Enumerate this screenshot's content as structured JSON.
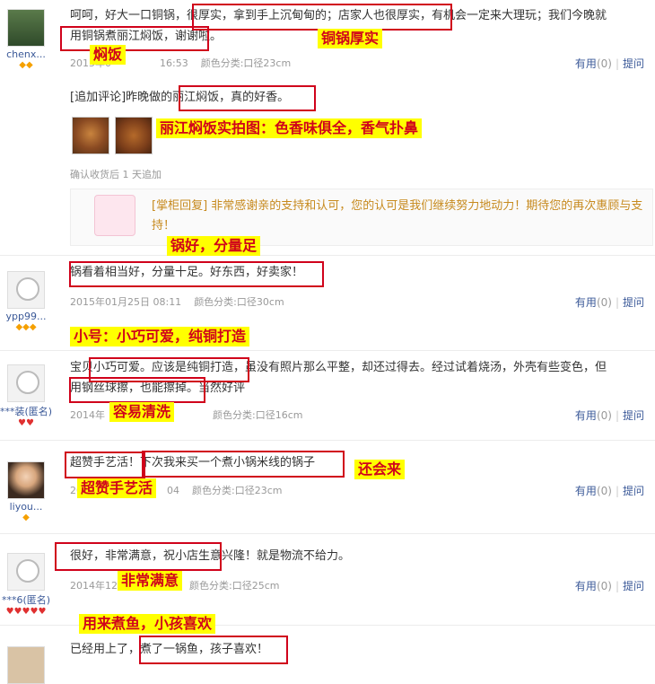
{
  "labels": {
    "useful": "有用",
    "useful_count": "(0)",
    "ask": "提问"
  },
  "reviews": [
    {
      "user": "chenx...",
      "badge": "◆◆",
      "text_lines": [
        "呵呵，好大一口铜锅，很厚实，拿到手上沉甸甸的；店家人也很厚实，有机会一定来大理玩；我们今晚就",
        "用铜锅煮丽江焖饭，谢谢啦。"
      ],
      "date": "2015年0",
      "time": "16:53",
      "spec": "颜色分类:口径23cm",
      "followup_label": "[追加评论]",
      "followup_text": "昨晚做的丽江焖饭，真的好香。",
      "followup_note": "确认收货后 1 天追加",
      "reply": "[掌柜回复] 非常感谢亲的支持和认可，您的认可是我们继续努力地动力！期待您的再次惠顾与支持！"
    },
    {
      "user": "ypp99...",
      "badge": "◆◆◆",
      "text": "锅看着相当好，分量十足。好东西，好卖家！",
      "date": "2015年01月25日 08:11",
      "spec": "颜色分类:口径30cm"
    },
    {
      "user": "***装(匿名)",
      "badge": "♥♥",
      "text_lines": [
        "宝贝小巧可爱。应该是纯铜打造，虽没有照片那么平整，却还过得去。经过试着烧汤，外壳有些变色，但",
        "用钢丝球擦，也能擦掉。当然好评"
      ],
      "date": "2014年",
      "spec": "颜色分类:口径16cm"
    },
    {
      "user": "liyou...",
      "badge": "◆",
      "text_a": "超赞手艺活！",
      "text_b": "下次我来买一个煮小锅米线的锅子",
      "date": "20",
      "time": "04",
      "spec": "颜色分类:口径23cm"
    },
    {
      "user": "***6(匿名)",
      "badge": "♥♥♥♥♥",
      "text": "很好，非常满意，祝小店生意兴隆！就是物流不给力。",
      "date": "2014年12",
      "spec": "颜色分类:口径25cm"
    },
    {
      "text": "已经用上了，煮了一锅鱼，孩子喜欢！"
    }
  ],
  "annotations": {
    "tonggu": "铜锅厚实",
    "menfan": "焖饭",
    "photo": "丽江焖饭实拍图：色香味俱全，香气扑鼻",
    "guohao": "锅好，分量足",
    "xiaohao": "小号：小巧可爱，纯铜打造",
    "qingxi": "容易清洗",
    "huanhuilai": "还会来",
    "chaozan": "超赞手艺活",
    "manyi": "非常满意",
    "zhuyu": "用来煮鱼，小孩喜欢"
  },
  "colors": {
    "annotation_red": "#d0021b",
    "annotation_bg": "#ffff00",
    "link": "#3b5998",
    "reply": "#c78a1e"
  }
}
